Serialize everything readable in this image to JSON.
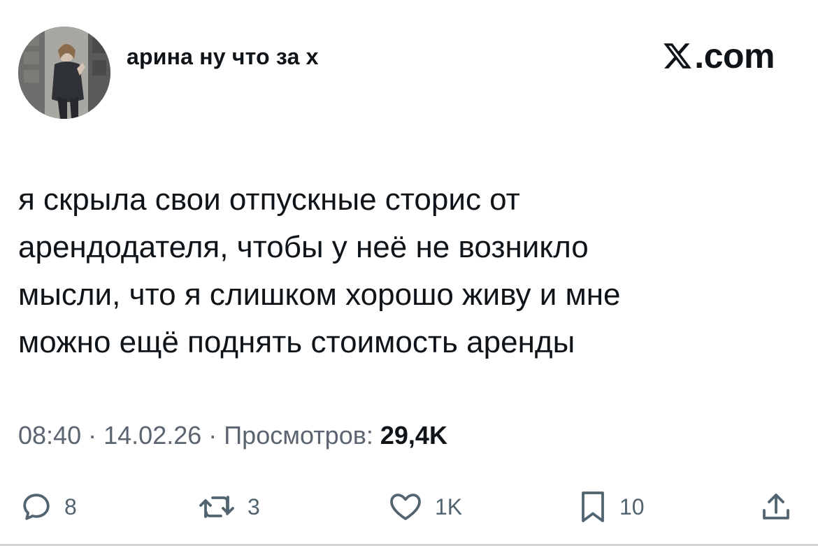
{
  "author": {
    "display_name": "арина ну что за х"
  },
  "brand": {
    "domain": ".com",
    "logo_icon": "x-logo-icon"
  },
  "tweet": {
    "lines": [
      "я скрыла свои отпускные сторис от",
      "арендодателя, чтобы у неё не возникло",
      "мысли, что я слишком хорошо живу и мне",
      "можно ещё поднять стоимость аренды"
    ]
  },
  "meta": {
    "time": "08:40",
    "separator": "·",
    "date": "14.02.26",
    "views_label": "Просмотров:",
    "views_count": "29,4K"
  },
  "actions": {
    "reply": {
      "icon": "reply-icon",
      "count": "8"
    },
    "retweet": {
      "icon": "retweet-icon",
      "count": "3"
    },
    "like": {
      "icon": "heart-icon",
      "count": "1K"
    },
    "bookmark": {
      "icon": "bookmark-icon",
      "count": "10"
    },
    "share": {
      "icon": "share-icon"
    }
  },
  "colors": {
    "text": "#0f1419",
    "secondary": "#536471",
    "background": "#ffffff"
  }
}
